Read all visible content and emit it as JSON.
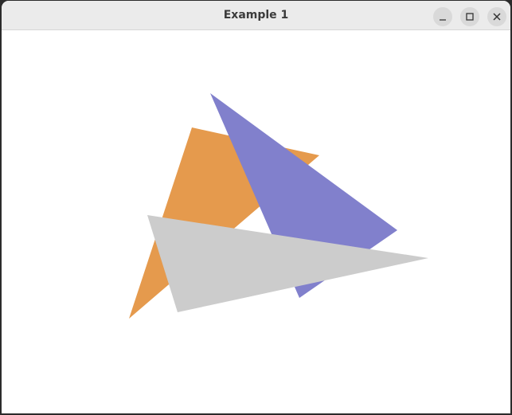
{
  "window": {
    "title": "Example 1"
  },
  "controls": {
    "minimize_icon": "minimize-icon",
    "maximize_icon": "maximize-icon",
    "close_icon": "close-icon"
  },
  "scene": {
    "background": "#ffffff",
    "shapes": [
      {
        "name": "orange-triangle",
        "color": "#e59a4d"
      },
      {
        "name": "purple-triangle",
        "color": "#8180cc"
      },
      {
        "name": "gray-triangle",
        "color": "#cccccc"
      }
    ]
  }
}
